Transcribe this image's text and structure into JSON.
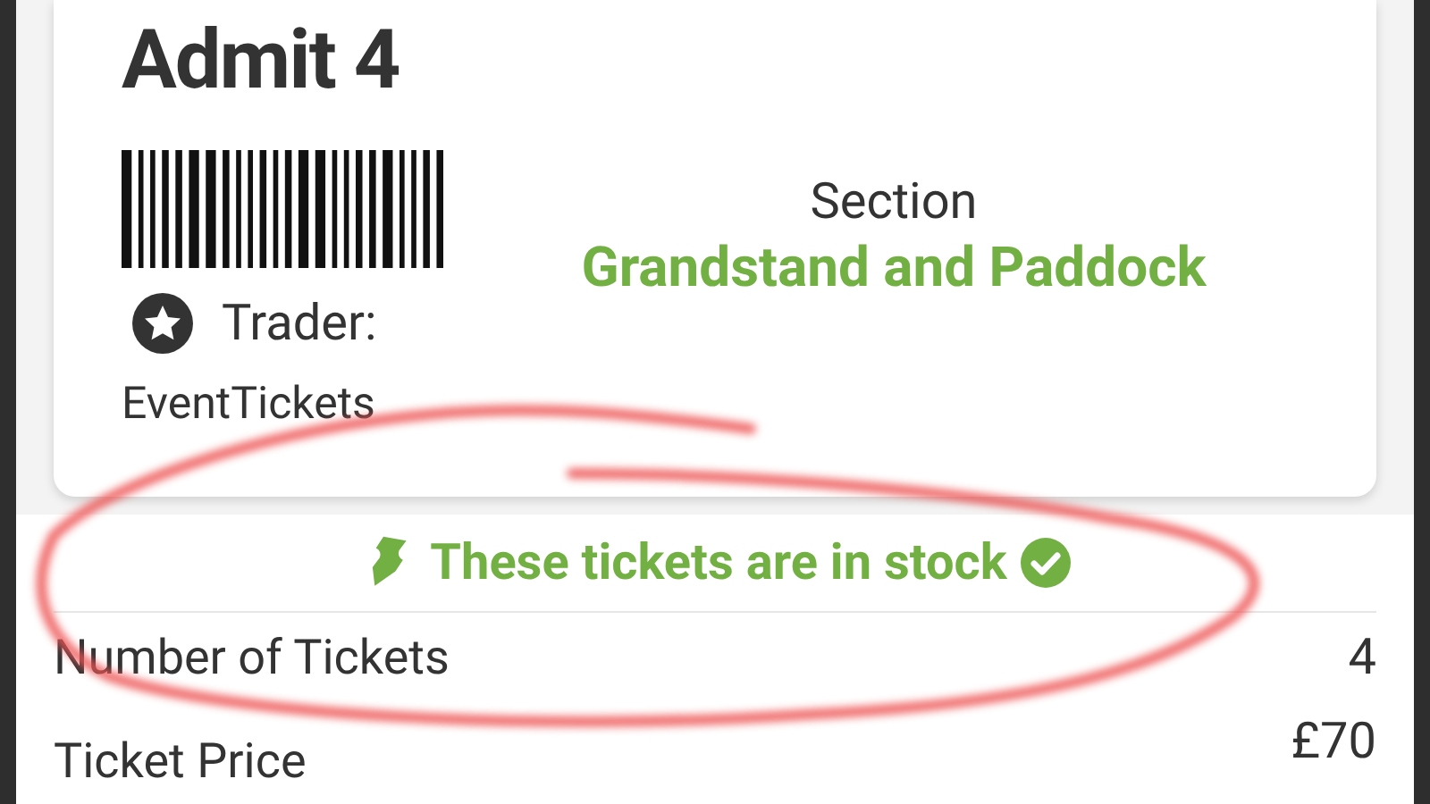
{
  "ticket": {
    "admit": "Admit 4",
    "section_label": "Section",
    "section": "Grandstand and Paddock",
    "trader_label": "Trader:",
    "trader": "EventTickets"
  },
  "stock_notice": {
    "text": "These tickets are in stock"
  },
  "details": [
    {
      "label": "Number of Tickets",
      "value": "4"
    },
    {
      "label": "Ticket Price",
      "value": "£70"
    }
  ]
}
